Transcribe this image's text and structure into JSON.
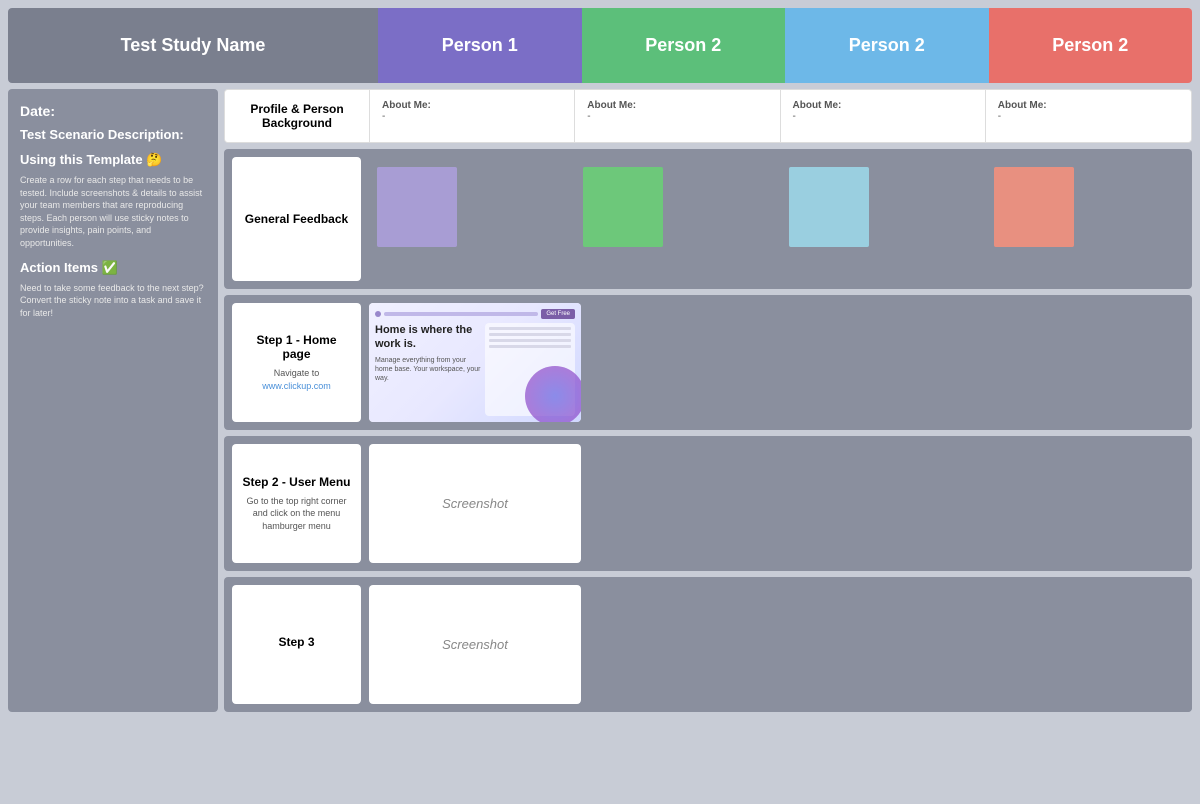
{
  "header": {
    "study_label": "Test Study Name",
    "person1_label": "Person 1",
    "person2a_label": "Person 2",
    "person2b_label": "Person 2",
    "person2c_label": "Person 2"
  },
  "sidebar": {
    "date_label": "Date:",
    "scenario_label": "Test Scenario Description:",
    "using_label": "Using this Template 🤔",
    "using_body": "Create a row for each step that needs to be tested. Include screenshots & details to assist your team members that are reproducing steps. Each person will use sticky notes to provide insights, pain points, and opportunities.",
    "action_label": "Action Items ✅",
    "action_body": "Need to take some feedback to the next step? Convert the sticky note into a task and save it for later!"
  },
  "profile": {
    "label": "Profile & Person Background",
    "about_label": "About Me:",
    "about_value": "-",
    "persons": [
      {
        "about_label": "About Me:",
        "about_value": "-"
      },
      {
        "about_label": "About Me:",
        "about_value": "-"
      },
      {
        "about_label": "About Me:",
        "about_value": "-"
      },
      {
        "about_label": "About Me:",
        "about_value": "-"
      }
    ]
  },
  "general_feedback": {
    "label": "General Feedback"
  },
  "steps": [
    {
      "title": "Step 1 - Home page",
      "description": "Navigate to",
      "link_text": "www.clickup.com",
      "has_screenshot_image": true,
      "screenshot_label": ""
    },
    {
      "title": "Step 2 - User Menu",
      "description": "Go to the top right corner and click on the menu hamburger menu",
      "link_text": "",
      "has_screenshot_image": false,
      "screenshot_label": "Screenshot"
    },
    {
      "title": "Step 3",
      "description": "",
      "link_text": "",
      "has_screenshot_image": false,
      "screenshot_label": "Screenshot"
    }
  ]
}
